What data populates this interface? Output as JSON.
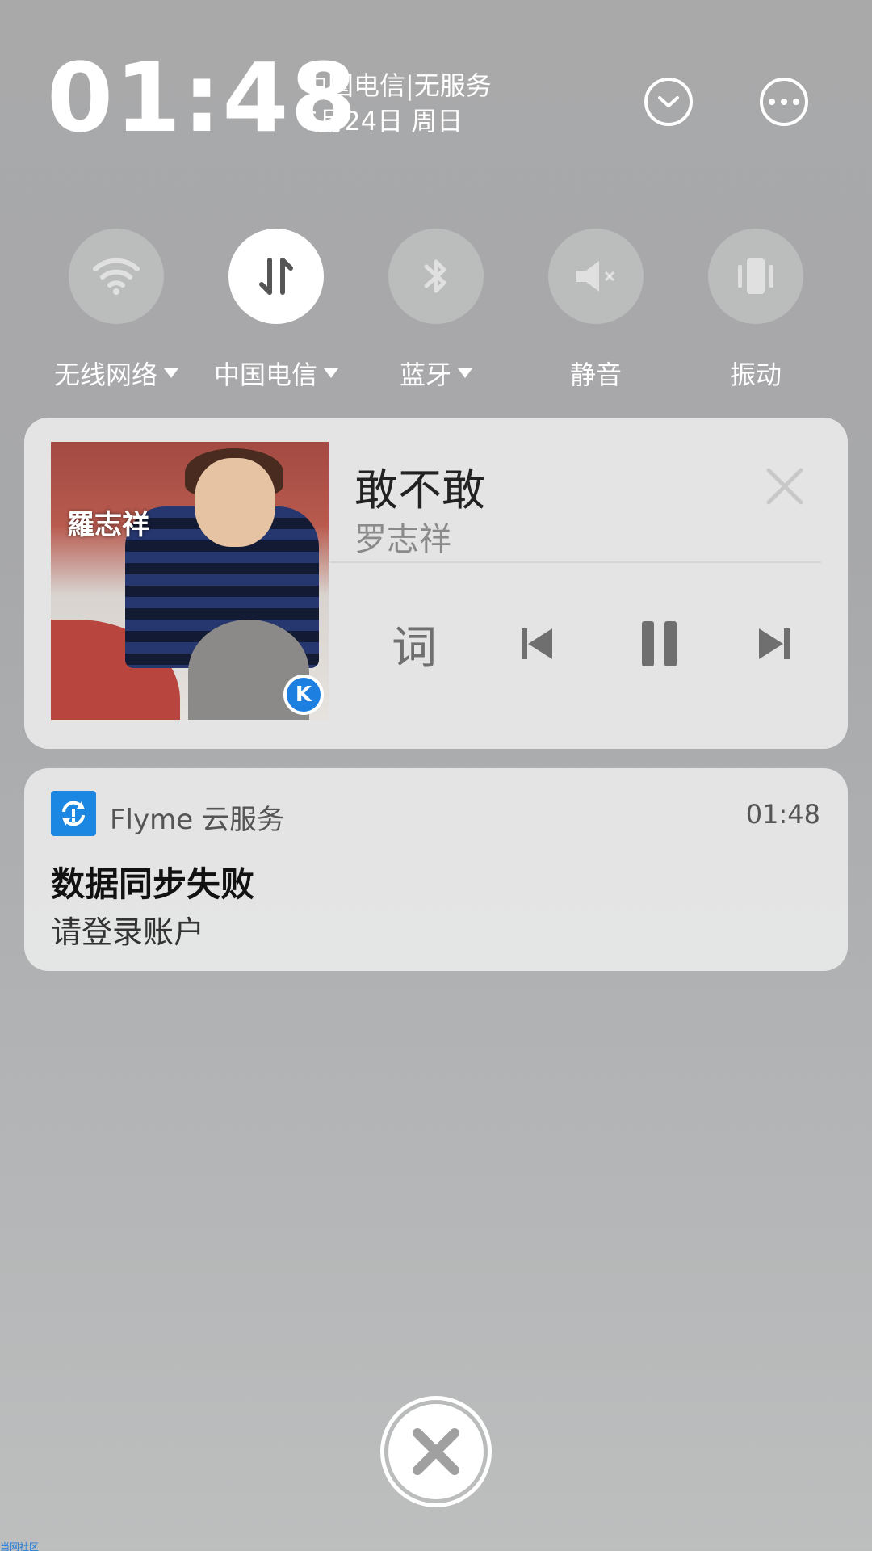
{
  "header": {
    "time": "01:48",
    "carrier": "中国电信|无服务",
    "date": "6月24日 周日"
  },
  "toggles": [
    {
      "label": "无线网络",
      "icon": "wifi-icon",
      "active": false,
      "has_dropdown": true
    },
    {
      "label": "中国电信",
      "icon": "mobile-data-icon",
      "active": true,
      "has_dropdown": true
    },
    {
      "label": "蓝牙",
      "icon": "bluetooth-icon",
      "active": false,
      "has_dropdown": true
    },
    {
      "label": "静音",
      "icon": "mute-icon",
      "active": false,
      "has_dropdown": false
    },
    {
      "label": "振动",
      "icon": "vibrate-icon",
      "active": false,
      "has_dropdown": false
    }
  ],
  "music": {
    "album_text": "羅志祥",
    "album_badge": "K",
    "title": "敢不敢",
    "artist": "罗志祥",
    "lyrics_label": "词"
  },
  "notification": {
    "app_name": "Flyme 云服务",
    "time": "01:48",
    "title": "数据同步失败",
    "subtitle": "请登录账户"
  },
  "watermark": "当网社区",
  "colors": {
    "accent_blue": "#1c86e3",
    "card_bg": "#e8e8e8",
    "control_gray": "#6f6f6f"
  }
}
